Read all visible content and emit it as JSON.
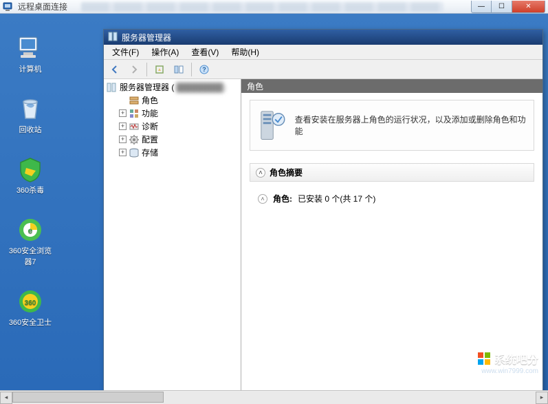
{
  "rdp": {
    "title": "远程桌面连接"
  },
  "window_controls": {
    "minimize": "—",
    "maximize": "☐",
    "close": "✕"
  },
  "desktop_icons": [
    {
      "key": "computer",
      "label": "计算机"
    },
    {
      "key": "recycle",
      "label": "回收站"
    },
    {
      "key": "360sd",
      "label": "360杀毒"
    },
    {
      "key": "360se",
      "label": "360安全浏览器7"
    },
    {
      "key": "360safe",
      "label": "360安全卫士"
    }
  ],
  "server_manager": {
    "title": "服务器管理器",
    "menus": [
      {
        "key": "file",
        "label": "文件(F)"
      },
      {
        "key": "action",
        "label": "操作(A)"
      },
      {
        "key": "view",
        "label": "查看(V)"
      },
      {
        "key": "help",
        "label": "帮助(H)"
      }
    ],
    "tree": {
      "root_label": "服务器管理器 (",
      "children": [
        {
          "key": "roles",
          "label": "角色",
          "expandable": false
        },
        {
          "key": "features",
          "label": "功能",
          "expandable": true
        },
        {
          "key": "diagnostics",
          "label": "诊断",
          "expandable": true
        },
        {
          "key": "configuration",
          "label": "配置",
          "expandable": true
        },
        {
          "key": "storage",
          "label": "存储",
          "expandable": true
        }
      ]
    },
    "content": {
      "header": "角色",
      "intro": "查看安装在服务器上角色的运行状况，以及添加或删除角色和功能",
      "section_title": "角色摘要",
      "roles_line_label": "角色:",
      "roles_line_value": "已安装 0 个(共 17 个)"
    }
  },
  "watermark": {
    "brand": "系统吧分",
    "url": "www.win7999.com"
  }
}
